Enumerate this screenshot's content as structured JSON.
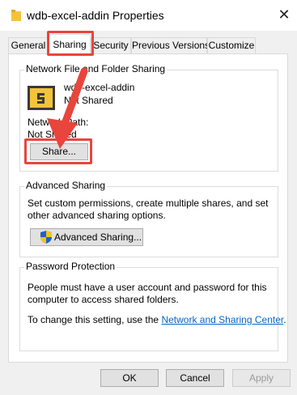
{
  "window": {
    "title": "wdb-excel-addin Properties",
    "close_glyph": "✕"
  },
  "tabs": [
    {
      "label": "General"
    },
    {
      "label": "Sharing"
    },
    {
      "label": "Security"
    },
    {
      "label": "Previous Versions"
    },
    {
      "label": "Customize"
    }
  ],
  "network_sharing": {
    "group_label": "Network File and Folder Sharing",
    "folder_name": "wdb-excel-addin",
    "status": "Not Shared",
    "network_path_label": "Network Path:",
    "network_path_value": "Not Shared",
    "share_button": "Share..."
  },
  "advanced_sharing": {
    "group_label": "Advanced Sharing",
    "description": "Set custom permissions, create multiple shares, and set other advanced sharing options.",
    "button": "Advanced Sharing..."
  },
  "password_protection": {
    "group_label": "Password Protection",
    "description": "People must have a user account and password for this computer to access shared folders.",
    "change_prefix": "To change this setting, use the ",
    "link_text": "Network and Sharing Center",
    "change_suffix": "."
  },
  "dialog_buttons": {
    "ok": "OK",
    "cancel": "Cancel",
    "apply": "Apply"
  },
  "colors": {
    "highlight": "#e8453c",
    "link": "#0066cc",
    "folder_yellow": "#f3c33b"
  },
  "icons": {
    "title_icon": "folder-icon",
    "shared_icon": "shared-folder-icon",
    "shield_icon": "uac-shield-icon",
    "annotation": "red-arrow-icon"
  }
}
